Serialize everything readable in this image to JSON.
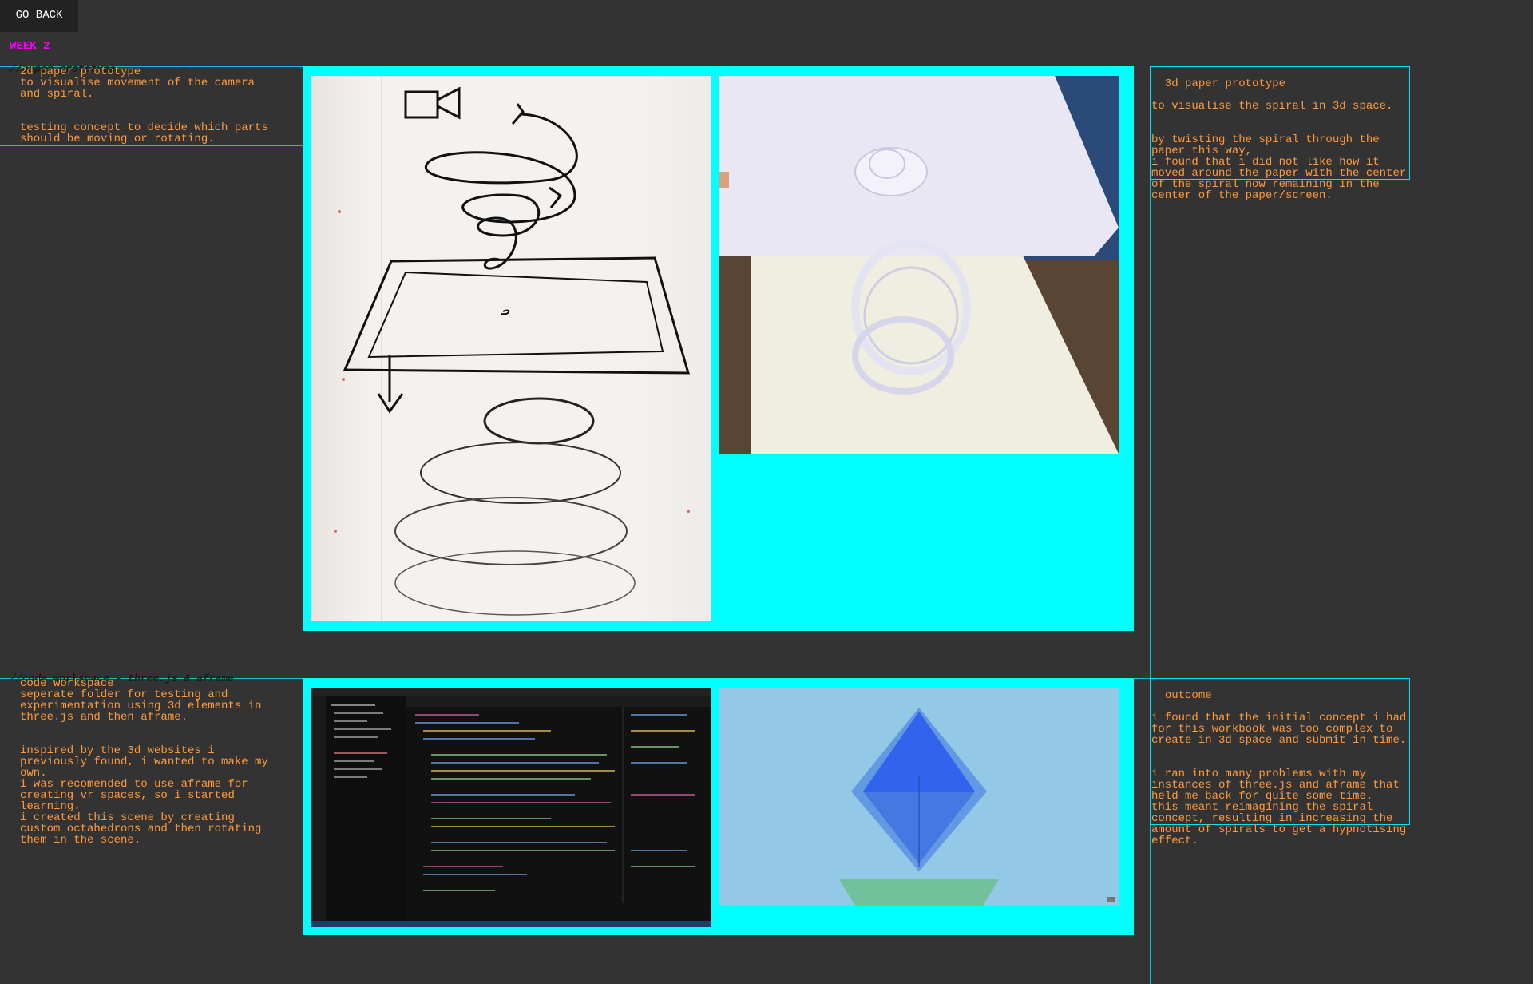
{
  "nav": {
    "go_back_label": "GO BACK"
  },
  "week_label": "WEEK 2",
  "sections": [
    {
      "label": "//paper prototype",
      "left_title": "2d paper prototype",
      "left_text": "to visualise movement of the camera\nand spiral.\n\n\ntesting concept to decide which parts\nshould be moving or rotating.",
      "right_title": "3d paper prototype",
      "right_text": "to visualise the spiral in 3d space.\n\n\nby twisting the spiral through the\npaper this way,\ni found that i did not like how it\nmoved around the paper with the center\nof the spiral now remaining in the\ncenter of the paper/screen."
    },
    {
      "label": "//code workspace - three.js & aframe",
      "left_title": "code workspace",
      "left_text": "seperate folder for testing and\nexperimentation using 3d elements in\nthree.js and then aframe.\n\n\ninspired by the 3d websites i\npreviously found, i wanted to make my\nown.\ni was recomended to use aframe for\ncreating vr spaces, so i started\nlearning.\ni created this scene by creating\ncustom octahedrons and then rotating\nthem in the scene.",
      "right_title": "outcome",
      "right_text": "i found that the initial concept i had\nfor this workbook was too complex to\ncreate in 3d space and submit in time.\n\n\ni ran into many problems with my\ninstances of three.js and aframe that\nheld me back for quite some time.\nthis meant reimagining the spiral\nconcept, resulting in increasing the\namount of spirals to get a hypnotising\neffect."
    }
  ],
  "colors": {
    "accent_cyan": "#00ffff",
    "text_orange": "#ff9a3c",
    "week_magenta": "#ff00ff",
    "background": "#333333"
  }
}
